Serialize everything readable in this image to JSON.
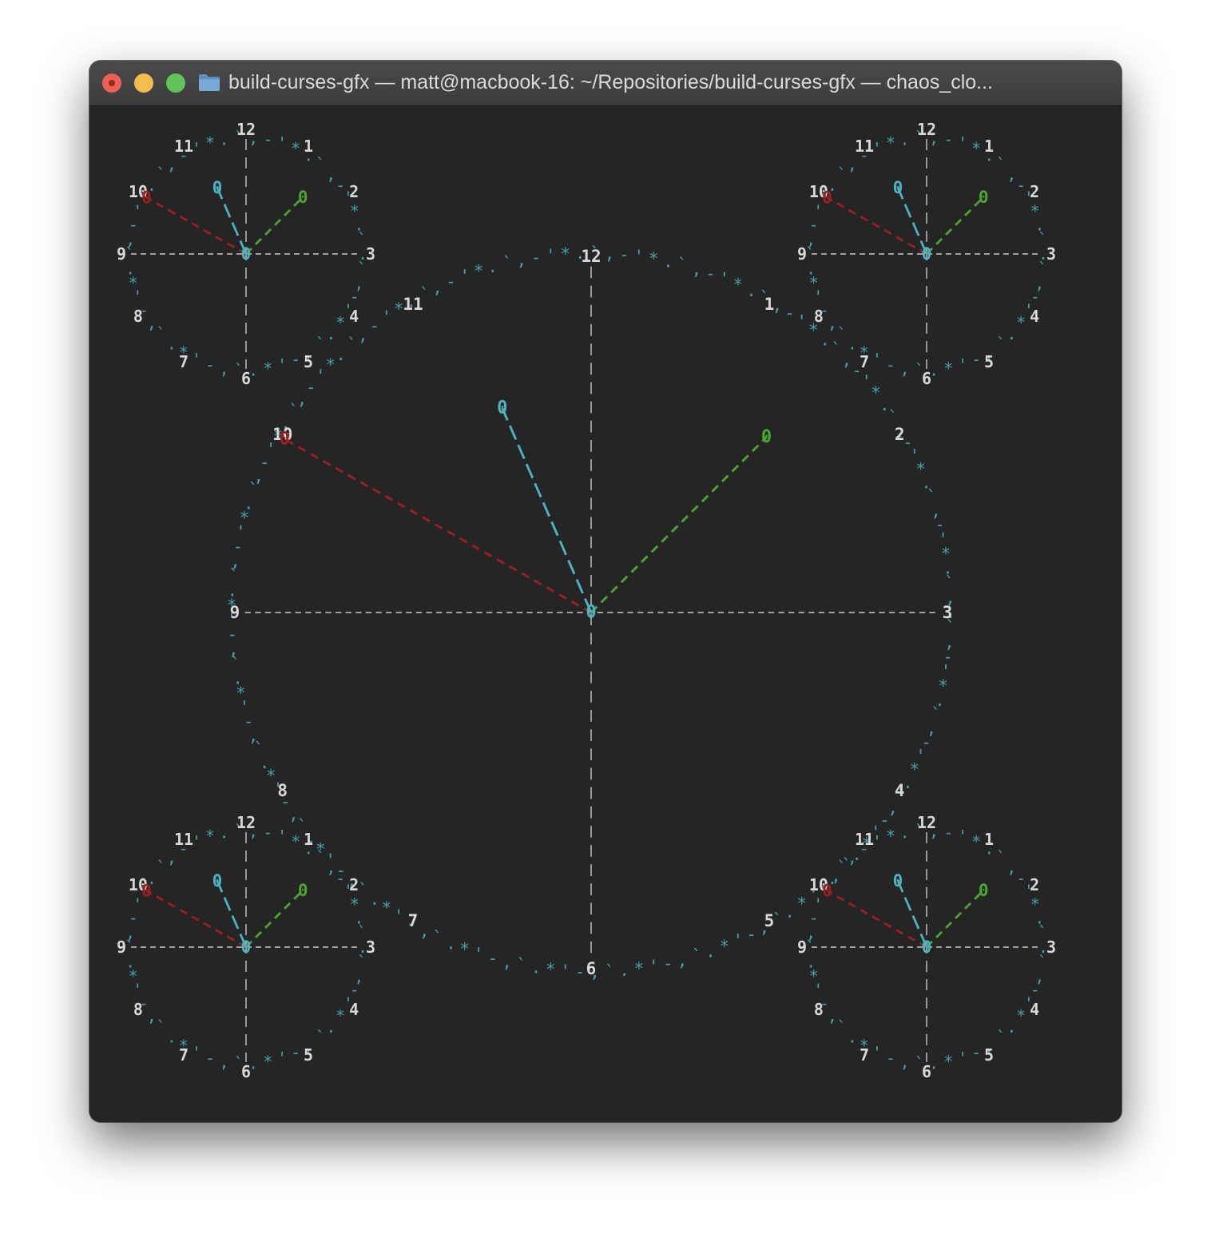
{
  "window": {
    "title": "build-curses-gfx — matt@macbook-16: ~/Repositories/build-curses-gfx — chaos_clo..."
  },
  "icons": {
    "close": "close-button",
    "minimize": "minimize-button",
    "zoom": "zoom-button",
    "folder": "folder-icon"
  },
  "colors": {
    "background": "#252525",
    "numerals": "#d8d8d8",
    "dots": "#3fa1ad",
    "hour_hand": "#9c1f1f",
    "minute_hand": "#4bb2bf",
    "second_hand": "#4aa62e",
    "axes": "#c9c9c9"
  },
  "clocks": {
    "main": {
      "numerals": [
        "12",
        "1",
        "2",
        "3",
        "4",
        "5",
        "6",
        "7",
        "8",
        "9",
        "10",
        "11"
      ],
      "center_glyph": "0",
      "hand_tip_glyph": "0"
    },
    "corners": {
      "numerals": [
        "12",
        "1",
        "2",
        "3",
        "4",
        "5",
        "6",
        "7",
        "8",
        "9",
        "10",
        "11"
      ],
      "center_glyph": "0",
      "hand_tip_glyph": "0"
    }
  }
}
